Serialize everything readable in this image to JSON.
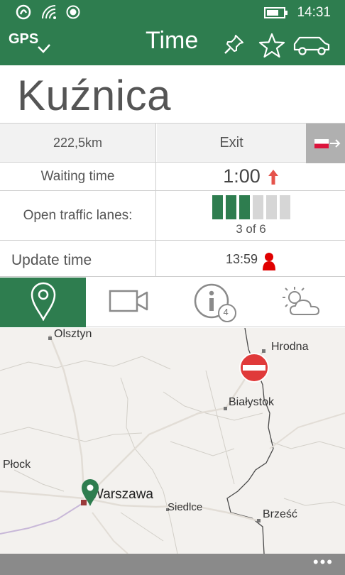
{
  "status_bar": {
    "time": "14:31",
    "icons": [
      "nfc-icon",
      "signal-wifi-icon",
      "location-dot-icon",
      "battery-icon"
    ]
  },
  "app_bar": {
    "gps_label": "GPS",
    "title": "Time",
    "buttons": [
      "pin-icon",
      "star-icon",
      "car-icon"
    ]
  },
  "crossing": {
    "name": "Kuźnica",
    "distance": "222,5km",
    "exit_label": "Exit",
    "waiting_label": "Waiting time",
    "waiting_value": "1:00",
    "waiting_trend": "up",
    "lanes_label": "Open traffic lanes:",
    "lanes_open": 3,
    "lanes_total": 6,
    "lanes_text": "3 of 6",
    "update_label": "Update time",
    "update_value": "13:59"
  },
  "tabs": [
    {
      "name": "location",
      "icon": "map-pin-icon",
      "active": true
    },
    {
      "name": "camera",
      "icon": "video-camera-icon",
      "active": false
    },
    {
      "name": "info",
      "icon": "info-icon",
      "badge": "4",
      "active": false
    },
    {
      "name": "weather",
      "icon": "sun-cloud-icon",
      "active": false
    }
  ],
  "map": {
    "places": {
      "olsztyn": "Olsztyn",
      "hrodna": "Hrodna",
      "bialystok": "Białystok",
      "plock": "Płock",
      "warszawa": "Warszawa",
      "siedlce": "Siedlce",
      "brzesc": "Brześć"
    }
  },
  "bottom_bar": {
    "more": "•••"
  },
  "colors": {
    "brand_green": "#2e7d4f",
    "lane_open": "#2e7d4f",
    "lane_closed": "#d6d6d6",
    "trend_red": "#e5534b",
    "border_red": "#e03a3a"
  }
}
